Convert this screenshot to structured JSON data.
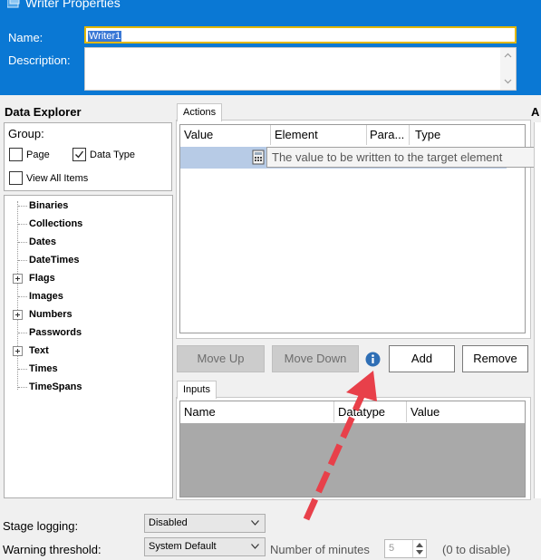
{
  "window": {
    "title": "Writer Properties",
    "icon": "writer-stage-icon"
  },
  "header": {
    "name_label": "Name:",
    "name_value": "Writer1",
    "description_label": "Description:",
    "description_value": ""
  },
  "data_explorer": {
    "title": "Data Explorer",
    "group_label": "Group:",
    "checkboxes": [
      {
        "label": "Page",
        "checked": false
      },
      {
        "label": "Data Type",
        "checked": true
      },
      {
        "label": "View All Items",
        "checked": false
      }
    ],
    "tree": [
      {
        "label": "Binaries",
        "expandable": false
      },
      {
        "label": "Collections",
        "expandable": false
      },
      {
        "label": "Dates",
        "expandable": false
      },
      {
        "label": "DateTimes",
        "expandable": false
      },
      {
        "label": "Flags",
        "expandable": true
      },
      {
        "label": "Images",
        "expandable": false
      },
      {
        "label": "Numbers",
        "expandable": true
      },
      {
        "label": "Passwords",
        "expandable": false
      },
      {
        "label": "Text",
        "expandable": true
      },
      {
        "label": "Times",
        "expandable": false
      },
      {
        "label": "TimeSpans",
        "expandable": false
      }
    ]
  },
  "actions": {
    "tab_label": "Actions",
    "columns": [
      "Value",
      "Element",
      "Para...",
      "Type"
    ],
    "tooltip": "The value to be written to the target element",
    "buttons": {
      "move_up": "Move Up",
      "move_down": "Move Down",
      "add": "Add",
      "remove": "Remove"
    },
    "info_icon": "info-icon"
  },
  "inputs": {
    "tab_label": "Inputs",
    "columns": [
      "Name",
      "Datatype",
      "Value"
    ]
  },
  "right_panel": {
    "label": "A"
  },
  "bottom": {
    "stage_logging_label": "Stage logging:",
    "stage_logging_value": "Disabled",
    "warning_threshold_label": "Warning threshold:",
    "warning_threshold_value": "System Default",
    "minutes_label": "Number of minutes",
    "minutes_value": "5",
    "minutes_hint": "(0 to disable)"
  },
  "annotation": {
    "arrow_color": "#e8404a"
  }
}
